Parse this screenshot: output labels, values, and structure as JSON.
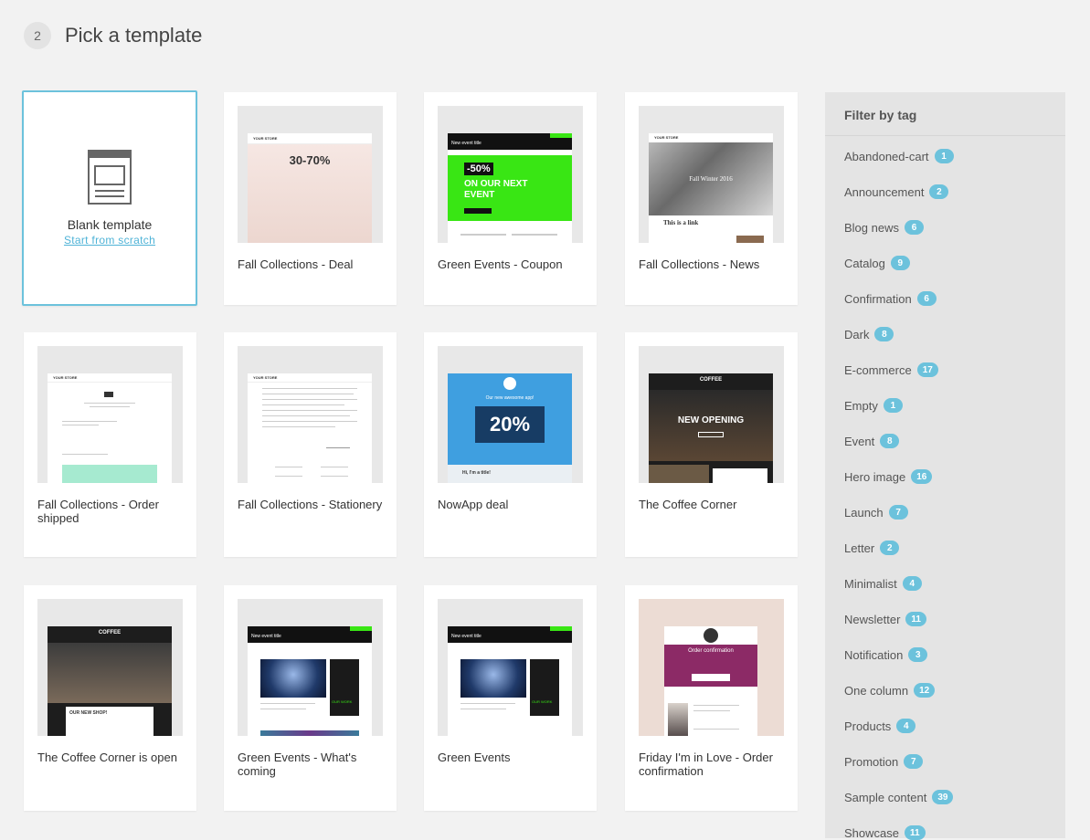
{
  "step": {
    "number": "2",
    "title": "Pick a template"
  },
  "blank": {
    "title": "Blank template",
    "link": "Start from scratch"
  },
  "templates": [
    {
      "label": "Fall Collections - Deal",
      "style": "deal",
      "store": "YOUR STORE",
      "text": "30-70%"
    },
    {
      "label": "Green Events - Coupon",
      "style": "coupon",
      "title": "New event title",
      "discount": "-50%",
      "headline": "ON OUR NEXT EVENT"
    },
    {
      "label": "Fall Collections - News",
      "style": "news",
      "store": "YOUR STORE",
      "headline": "This is a link",
      "banner": "Fall Winter 2016"
    },
    {
      "label": "Fall Collections - Order shipped",
      "style": "order",
      "store": "YOUR STORE"
    },
    {
      "label": "Fall Collections - Stationery",
      "style": "stationery",
      "store": "YOUR STORE"
    },
    {
      "label": "NowApp deal",
      "style": "nowapp",
      "text": "20%",
      "sub": "Our new awesome app!",
      "footer": "Hi, I'm a title!"
    },
    {
      "label": "The Coffee Corner",
      "style": "coffee",
      "brand": "COFFEE",
      "headline": "NEW OPENING"
    },
    {
      "label": "The Coffee Corner is open",
      "style": "coffee2",
      "brand": "COFFEE",
      "headline": "OUR NEW SHOP!"
    },
    {
      "label": "Green Events - What's coming",
      "style": "green",
      "title": "New event title",
      "work": "OUR WORK"
    },
    {
      "label": "Green Events",
      "style": "green",
      "title": "New event title",
      "work": "OUR WORK"
    },
    {
      "label": "Friday I'm in Love - Order confirmation",
      "style": "friday",
      "headline": "Order confirmation"
    }
  ],
  "sidebar": {
    "title": "Filter by tag",
    "tags": [
      {
        "name": "Abandoned-cart",
        "count": "1"
      },
      {
        "name": "Announcement",
        "count": "2"
      },
      {
        "name": "Blog news",
        "count": "6"
      },
      {
        "name": "Catalog",
        "count": "9"
      },
      {
        "name": "Confirmation",
        "count": "6"
      },
      {
        "name": "Dark",
        "count": "8"
      },
      {
        "name": "E-commerce",
        "count": "17"
      },
      {
        "name": "Empty",
        "count": "1"
      },
      {
        "name": "Event",
        "count": "8"
      },
      {
        "name": "Hero image",
        "count": "16"
      },
      {
        "name": "Launch",
        "count": "7"
      },
      {
        "name": "Letter",
        "count": "2"
      },
      {
        "name": "Minimalist",
        "count": "4"
      },
      {
        "name": "Newsletter",
        "count": "11"
      },
      {
        "name": "Notification",
        "count": "3"
      },
      {
        "name": "One column",
        "count": "12"
      },
      {
        "name": "Products",
        "count": "4"
      },
      {
        "name": "Promotion",
        "count": "7"
      },
      {
        "name": "Sample content",
        "count": "39"
      },
      {
        "name": "Showcase",
        "count": "11"
      }
    ]
  },
  "colors": {
    "accent": "#6cc2dc",
    "green": "#39e614",
    "blue": "#3f9fe0",
    "plum": "#8c2a66"
  }
}
